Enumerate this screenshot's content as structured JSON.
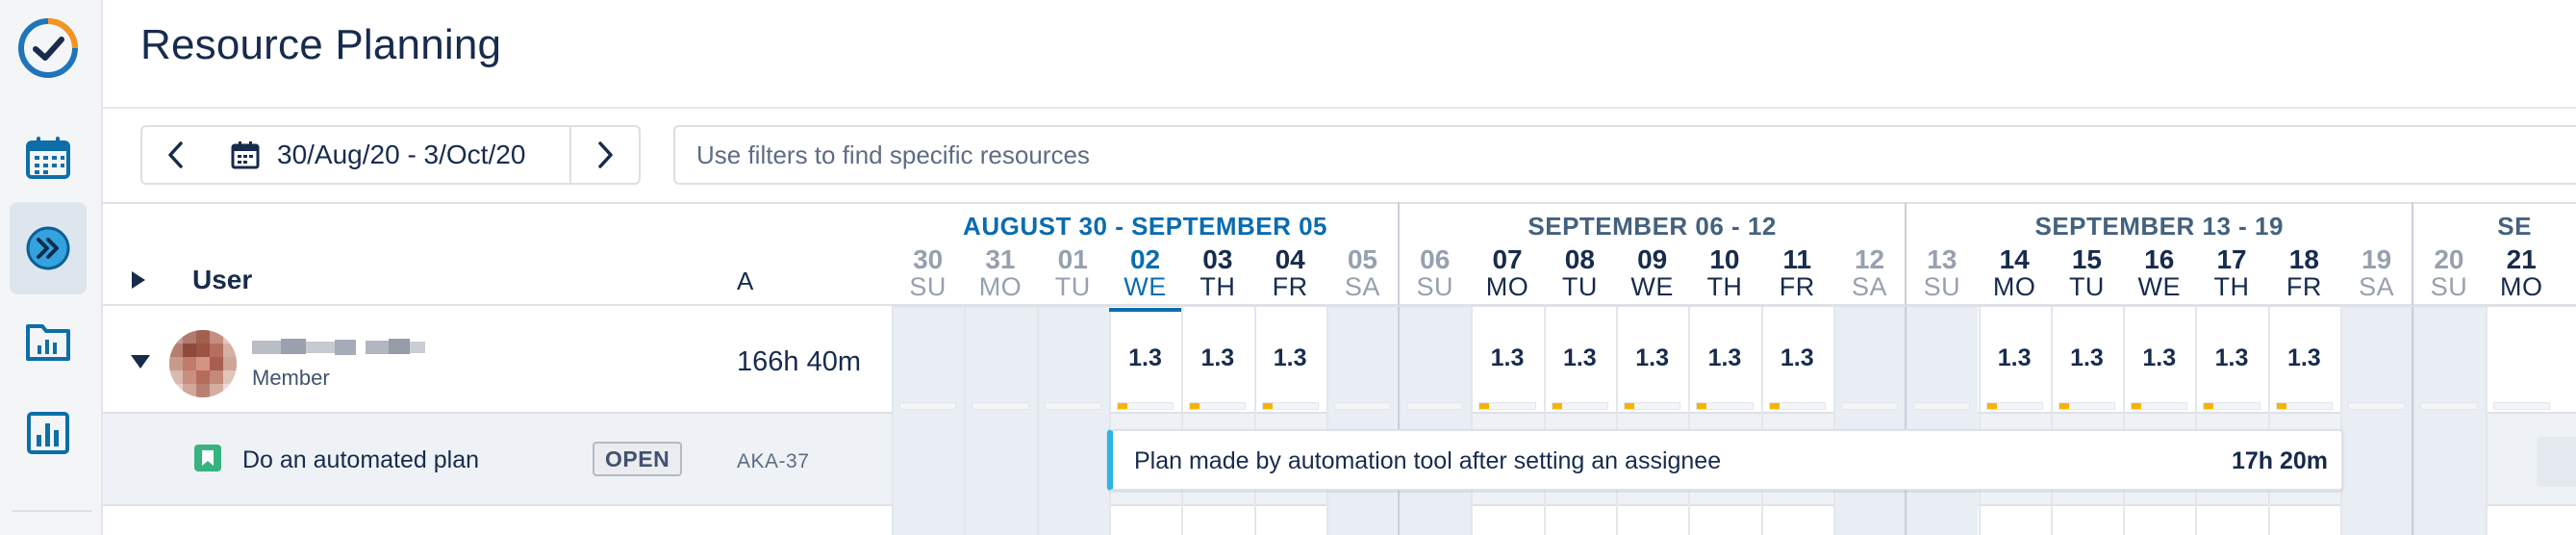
{
  "app": {
    "title": "Resource Planning"
  },
  "sidebar": {
    "items": [
      {
        "name": "logo",
        "icon": "check-circle-logo-icon"
      },
      {
        "name": "calendar",
        "icon": "calendar-icon"
      },
      {
        "name": "resource-planning",
        "icon": "double-chevron-right-icon",
        "active": true
      },
      {
        "name": "folder-reports",
        "icon": "folder-chart-icon"
      },
      {
        "name": "reports",
        "icon": "bar-chart-icon"
      }
    ]
  },
  "toolbar": {
    "date_range": "30/Aug/20 - 3/Oct/20",
    "filter_placeholder": "Use filters to find specific resources"
  },
  "table": {
    "columns": {
      "user": "User",
      "a": "A"
    },
    "user_row": {
      "role": "Member",
      "total": "166h 40m"
    },
    "task_row": {
      "name": "Do an automated plan",
      "status": "OPEN",
      "key": "AKA-37"
    }
  },
  "timeline": {
    "weeks": [
      {
        "label": "AUGUST 30 - SEPTEMBER 05",
        "current": true
      },
      {
        "label": "SEPTEMBER 06 - 12"
      },
      {
        "label": "SEPTEMBER 13 - 19"
      },
      {
        "label": "SE"
      }
    ],
    "days": [
      {
        "num": "30",
        "name": "SU",
        "weekend": true
      },
      {
        "num": "31",
        "name": "MO",
        "weekend": true
      },
      {
        "num": "01",
        "name": "TU",
        "weekend": true
      },
      {
        "num": "02",
        "name": "WE",
        "today": true,
        "hours": "1.3"
      },
      {
        "num": "03",
        "name": "TH",
        "hours": "1.3"
      },
      {
        "num": "04",
        "name": "FR",
        "hours": "1.3"
      },
      {
        "num": "05",
        "name": "SA",
        "weekend": true
      },
      {
        "num": "06",
        "name": "SU",
        "weekend": true
      },
      {
        "num": "07",
        "name": "MO",
        "hours": "1.3"
      },
      {
        "num": "08",
        "name": "TU",
        "hours": "1.3"
      },
      {
        "num": "09",
        "name": "WE",
        "hours": "1.3"
      },
      {
        "num": "10",
        "name": "TH",
        "hours": "1.3"
      },
      {
        "num": "11",
        "name": "FR",
        "hours": "1.3"
      },
      {
        "num": "12",
        "name": "SA",
        "weekend": true
      },
      {
        "num": "13",
        "name": "SU",
        "weekend": true
      },
      {
        "num": "14",
        "name": "MO",
        "hours": "1.3"
      },
      {
        "num": "15",
        "name": "TU",
        "hours": "1.3"
      },
      {
        "num": "16",
        "name": "WE",
        "hours": "1.3"
      },
      {
        "num": "17",
        "name": "TH",
        "hours": "1.3"
      },
      {
        "num": "18",
        "name": "FR",
        "hours": "1.3"
      },
      {
        "num": "19",
        "name": "SA",
        "weekend": true
      },
      {
        "num": "20",
        "name": "SU",
        "weekend": true
      },
      {
        "num": "21",
        "name": "MO"
      }
    ],
    "plan": {
      "text": "Plan made by automation tool after setting an assignee",
      "hours": "17h 20m"
    }
  },
  "colors": {
    "accent_blue": "#0a6cb0",
    "plan_bar_accent": "#2eb3e6",
    "status_open_bg": "#ebecf0",
    "task_icon_green": "#36b37e",
    "capacity_fill": "#f5b400"
  }
}
